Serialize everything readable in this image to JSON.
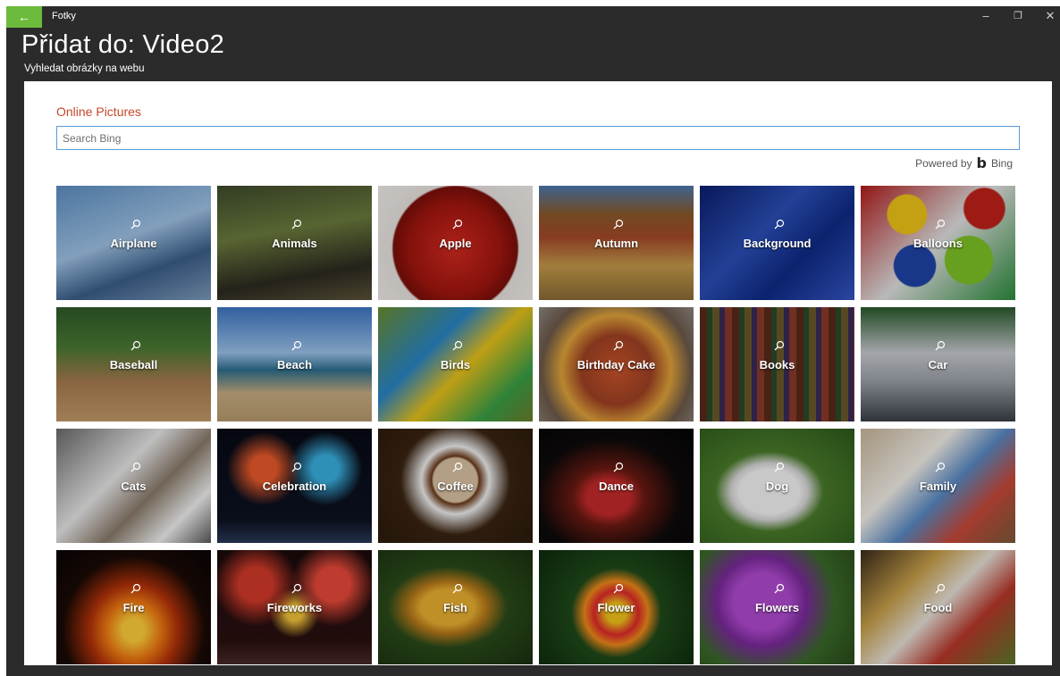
{
  "titlebar": {
    "back_icon": "←",
    "app_name": "Fotky",
    "minimize_icon": "–",
    "restore_icon": "❐",
    "close_icon": "✕"
  },
  "header": {
    "title": "Přidat do: Video2",
    "subtitle": "Vyhledat obrázky na webu"
  },
  "panel": {
    "section_title": "Online Pictures",
    "search_placeholder": "Search Bing",
    "search_value": "",
    "powered_by": "Powered by",
    "bing_logo": "b",
    "bing_label": "Bing"
  },
  "colors": {
    "accent_green": "#6cbb3c",
    "section_title": "#c4472a",
    "search_border": "#5b9bd5",
    "chrome": "#2b2b2b"
  },
  "categories": [
    {
      "label": "Airplane",
      "bg": "linear-gradient(160deg,#5d8fc4 0%,#9fc3e6 45%,#3b5f8a 70%,#7d9bbb 100%)"
    },
    {
      "label": "Animals",
      "bg": "linear-gradient(170deg,#3f4a2c 0%,#6b7b3d 40%,#2d2a20 75%,#5a5238 100%)"
    },
    {
      "label": "Apple",
      "bg": "radial-gradient(circle at 50% 55%,#d22a20 0%,#a3160f 45%,#7a0f0a 62%,#e9e4e0 64%,#f2efec 100%)"
    },
    {
      "label": "Autumn",
      "bg": "linear-gradient(180deg,#4d79b0 0%,#8a5a2a 25%,#a6492a 45%,#c59a4a 70%,#8b6b35 100%)"
    },
    {
      "label": "Background",
      "bg": "linear-gradient(135deg,#0b1f6e 0%,#2b4fb8 40%,#0f2a86 65%,#3556c4 100%)"
    },
    {
      "label": "Balloons",
      "bg": "radial-gradient(circle at 30% 25%,#f0c418 0 14%,transparent 15%),radial-gradient(circle at 70% 65%,#7ec225 0 18%,transparent 19%),radial-gradient(circle at 35% 70%,#1f44a8 0 16%,transparent 17%),radial-gradient(circle at 80% 20%,#c0201a 0 13%,transparent 14%),linear-gradient(135deg,#b21b1b,#e2e2e2 50%,#2a8c3a)"
    },
    {
      "label": "Baseball",
      "bg": "linear-gradient(180deg,#2f5a2a 0%,#4b7a33 35%,#a77c4f 65%,#c39a6b 100%)"
    },
    {
      "label": "Beach",
      "bg": "linear-gradient(180deg,#3d76c4 0%,#9cc3ea 40%,#2e6f8e 55%,#c7ad82 75%,#b89a6e 100%)"
    },
    {
      "label": "Birds",
      "bg": "linear-gradient(135deg,#6a8f2e 0%,#2a86c8 35%,#e9c21a 55%,#3aa046 80%,#6b7d2a 100%)"
    },
    {
      "label": "Birthday Cake",
      "bg": "radial-gradient(circle at 50% 55%,#c8532a 0%,#a04224 35%,#e2a43a 55%,#6d5a4a 75%,#8d8782 100%)"
    },
    {
      "label": "Books",
      "bg": "repeating-linear-gradient(90deg,#5a2a1a 0 8px,#2a4a2a 8px 14px,#6a5a2a 14px 22px,#3a2a5a 22px 28px,#8a3a2a 28px 36px)"
    },
    {
      "label": "Car",
      "bg": "linear-gradient(180deg,#2a5a2a 0%,#c8cbd0 40%,#9aa0a8 65%,#3a3f46 100%)"
    },
    {
      "label": "Cats",
      "bg": "linear-gradient(135deg,#6b6b6b 0%,#e8e8e8 40%,#8a7b6b 60%,#f2f2f2 80%,#5a5a5a 100%)"
    },
    {
      "label": "Celebration",
      "bg": "radial-gradient(circle at 30% 35%,#e85a2a 0 10%,transparent 28%),radial-gradient(circle at 70% 35%,#3ab0e0 0 10%,transparent 28%),linear-gradient(180deg,#070a14 0%,#0d1222 80%,#2a3a5a 100%)"
    },
    {
      "label": "Coffee",
      "bg": "radial-gradient(circle at 50% 45%,#d9c3a3 0 22%,#6a3a1a 24%,#f2f2f2 34%,#3a2412 55%,#2a1a0c 100%)"
    },
    {
      "label": "Dance",
      "bg": "radial-gradient(ellipse at 45% 60%,#c42a2a 0 18%,#6a1a12 30%,#0d0a0a 60%,#050505 100%)"
    },
    {
      "label": "Dog",
      "bg": "radial-gradient(ellipse at 45% 55%,#f4f4f4 0 25%,#d8d8d8 32%,#4a7a2a 45%,#2d5a1c 100%)"
    },
    {
      "label": "Family",
      "bg": "linear-gradient(135deg,#c9b79a 0%,#f3efe8 35%,#5a8ac4 55%,#c84a3a 75%,#7a5a3a 100%)"
    },
    {
      "label": "Fire",
      "bg": "radial-gradient(ellipse at 50% 70%,#ffcf3a 0 10%,#f07a12 25%,#b3320a 40%,#1a0a05 65%,#080404 100%)"
    },
    {
      "label": "Fireworks",
      "bg": "radial-gradient(circle at 25% 30%,#d23a2a 0 12%,transparent 30%),radial-gradient(circle at 75% 30%,#e84a3a 0 12%,transparent 30%),radial-gradient(circle at 50% 55%,#f2c23a 0 8%,transparent 25%),linear-gradient(180deg,#1a0a0a 0%,#2a1010 80%,#4a2a2a 100%)"
    },
    {
      "label": "Fish",
      "bg": "radial-gradient(ellipse at 45% 50%,#e8b030 0 22%,#b87a1a 32%,#2a4a1a 50%,#1a3010 100%)"
    },
    {
      "label": "Flower",
      "bg": "radial-gradient(circle at 50% 55%,#f2c21a 0 10%,#e02a2a 22%,#f08a1a 32%,#1f4a1a 45%,#0d2a0d 100%)"
    },
    {
      "label": "Flowers",
      "bg": "radial-gradient(circle at 40% 45%,#b04ad0 0 25%,#7a2a9a 40%,#3a6a2a 65%,#2a4a1a 100%)"
    },
    {
      "label": "Food",
      "bg": "linear-gradient(135deg,#3a2a1a 0%,#c8a04a 30%,#e8e2d8 50%,#b8382a 70%,#5a7a2a 100%)"
    }
  ]
}
